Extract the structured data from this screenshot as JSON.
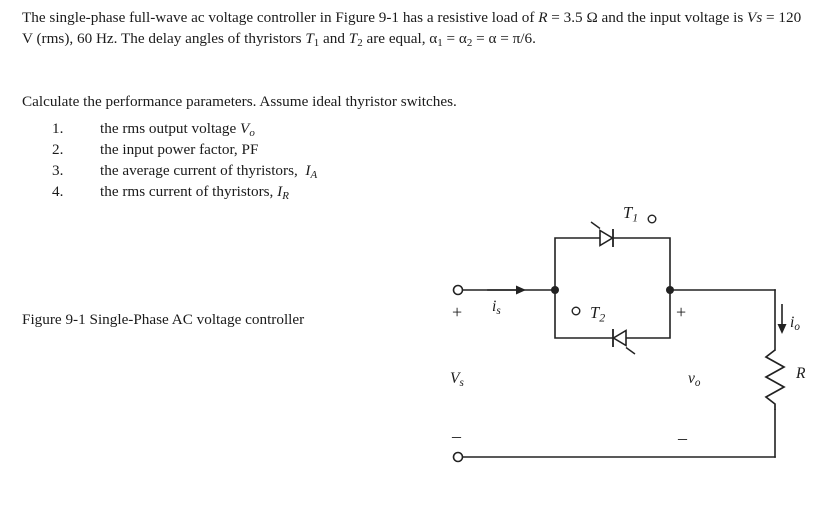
{
  "problem": {
    "intro": "The single-phase full-wave ac voltage controller in Figure 9-1 has a resistive load of R = 3.5 Ω and the input voltage is Vs = 120 V (rms), 60 Hz. The delay angles of thyristors T1 and T2 are equal, α1 = α2 = α = π/6.",
    "instruction": "Calculate the performance parameters. Assume ideal thyristor switches.",
    "items": [
      {
        "number": "1.",
        "text": "the rms output voltage Vo"
      },
      {
        "number": "2.",
        "text": "the input power factor, PF"
      },
      {
        "number": "3.",
        "text": "the average current of thyristors,  IA"
      },
      {
        "number": "4.",
        "text": "the rms current of thyristors, IR"
      }
    ]
  },
  "figure": {
    "caption": "Figure 9-1 Single-Phase AC voltage controller",
    "labels": {
      "thyristor1": "T",
      "thyristor1_sub": "1",
      "thyristor2": "T",
      "thyristor2_sub": "2",
      "source_current": "i",
      "source_current_sub": "s",
      "source_voltage": "V",
      "source_voltage_sub": "s",
      "output_current": "i",
      "output_current_sub": "o",
      "output_voltage": "v",
      "output_voltage_sub": "o",
      "resistor": "R",
      "plus_source": "+",
      "plus_output": "+",
      "minus_output": "–"
    }
  },
  "colors": {
    "text": "#1b1b1b",
    "wire": "#222222",
    "background": "#ffffff"
  }
}
